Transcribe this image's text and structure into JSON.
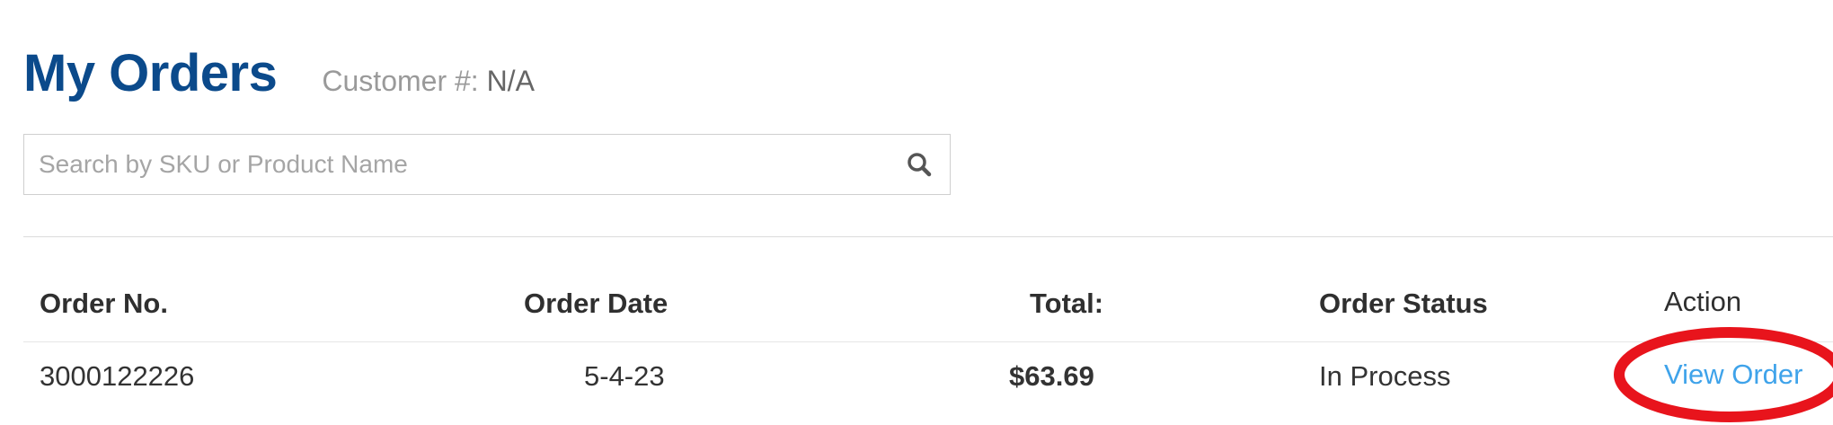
{
  "header": {
    "title": "My Orders",
    "customer_label": "Customer #:",
    "customer_value": "N/A"
  },
  "search": {
    "placeholder": "Search by SKU or Product Name",
    "value": "",
    "icon": "search-icon"
  },
  "table": {
    "headers": {
      "order_no": "Order No.",
      "order_date": "Order Date",
      "total": "Total:",
      "order_status": "Order Status",
      "action": "Action"
    },
    "rows": [
      {
        "order_no": "3000122226",
        "order_date": "5-4-23",
        "total": "$63.69",
        "order_status": "In Process",
        "action": "View Order"
      }
    ]
  },
  "colors": {
    "title": "#0b4a8b",
    "link": "#3fa3ea",
    "annotation": "#e8141c"
  }
}
